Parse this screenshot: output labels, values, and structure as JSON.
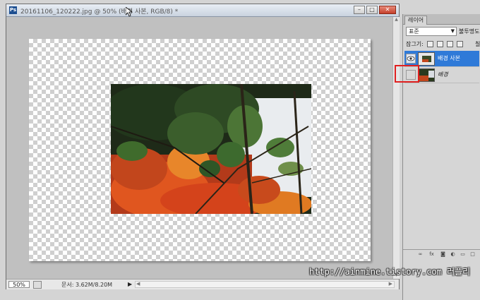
{
  "document": {
    "title": "20161106_120222.jpg @ 50% (배경 사본, RGB/8) *",
    "app_icon_label": "Ps",
    "zoom": "50%",
    "doc_size": "문서: 3.62M/8.20M"
  },
  "layers_panel": {
    "tab_label": "레이어",
    "blend_mode": "표준",
    "opacity_label": "불투명도",
    "lock_label": "잠그기:",
    "fill_label": "칠",
    "layers": [
      {
        "name": "배경 사본",
        "visible": true,
        "selected": true
      },
      {
        "name": "배경",
        "visible": false,
        "selected": false
      }
    ]
  },
  "watermark": "http://ainmine.tistory.com 러플리",
  "colors": {
    "selected_layer": "#2f7ad8",
    "highlight_box": "#e02020"
  },
  "icons": [
    "ps-app-icon",
    "minimize-icon",
    "maximize-icon",
    "close-icon",
    "eye-icon",
    "lock-icon",
    "link-icon",
    "fx-icon",
    "mask-icon",
    "adjustment-icon",
    "folder-icon",
    "new-layer-icon",
    "trash-icon"
  ]
}
